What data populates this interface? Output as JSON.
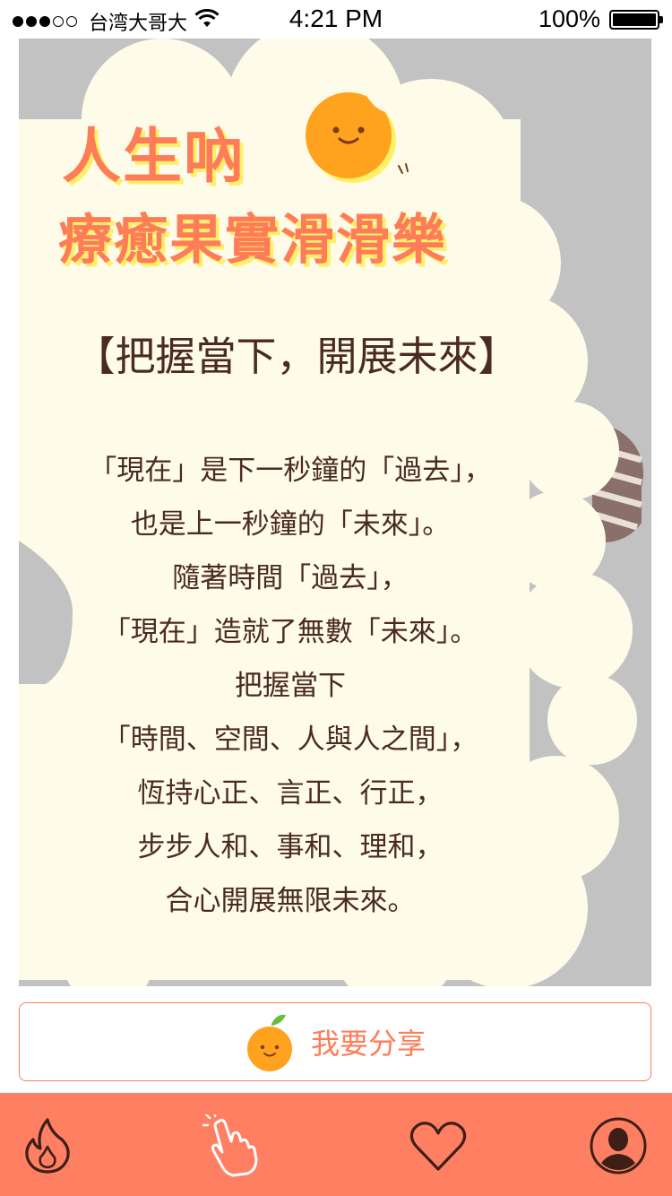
{
  "status_bar": {
    "carrier": "台湾大哥大",
    "time": "4:21 PM",
    "battery": "100%",
    "signal_bars_filled": 3,
    "signal_bars_total": 5
  },
  "card": {
    "title_line1": "人生吶",
    "title_line2": "療癒果實滑滑樂",
    "subtitle": "【把握當下，開展未來】",
    "poem": [
      "「現在」是下一秒鐘的「過去」，",
      "也是上一秒鐘的「未來」。",
      "隨著時間「過去」，",
      "「現在」造就了無數「未來」。",
      "把握當下",
      "「時間、空間、人與人之間」，",
      "恆持心正、言正、行正，",
      "步步人和、事和、理和，",
      "合心開展無限未來。"
    ]
  },
  "share_button": {
    "label": "我要分享",
    "icon": "orange-mascot-icon"
  },
  "tab_bar": {
    "items": [
      {
        "icon": "flame-icon"
      },
      {
        "icon": "hand-pointer-icon"
      },
      {
        "icon": "heart-icon"
      },
      {
        "icon": "user-avatar-icon"
      }
    ]
  },
  "colors": {
    "accent": "#ff7c58",
    "tab_bar": "#ff7f63",
    "title_shadow": "#fff06a",
    "cloud": "#fefce8",
    "text_brown": "#4a2a22",
    "card_gray": "#c2c2c2"
  }
}
